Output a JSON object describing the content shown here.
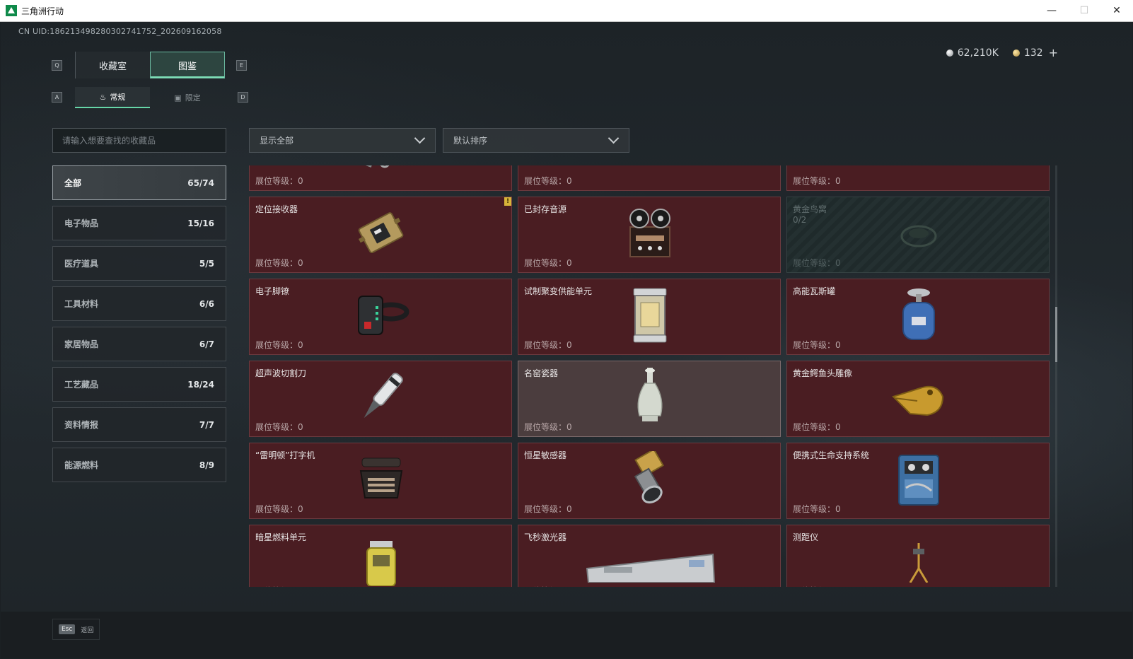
{
  "window": {
    "title": "三角洲行动"
  },
  "header": {
    "uid": "CN UID:1862134982803027417​52_202609162058",
    "currency": [
      {
        "icon": "silver-coin-icon",
        "value": "62,210K"
      },
      {
        "icon": "gold-coin-icon",
        "value": "132"
      }
    ],
    "plus": "+"
  },
  "keys": {
    "q": "Q",
    "e": "E",
    "a": "A",
    "d": "D"
  },
  "tabs": [
    {
      "label": "收藏室",
      "active": false
    },
    {
      "label": "图鉴",
      "active": true
    }
  ],
  "subtabs": [
    {
      "label": "常规",
      "icon": "flame-icon",
      "active": true
    },
    {
      "label": "限定",
      "icon": "image-icon",
      "active": false
    }
  ],
  "search": {
    "placeholder": "请输入想要查找的收藏品"
  },
  "filters": {
    "show": "显示全部",
    "sort": "默认排序"
  },
  "categories": [
    {
      "label": "全部",
      "count": "65/74",
      "active": true
    },
    {
      "label": "电子物品",
      "count": "15/16"
    },
    {
      "label": "医疗道具",
      "count": "5/5"
    },
    {
      "label": "工具材料",
      "count": "6/6"
    },
    {
      "label": "家居物品",
      "count": "6/7"
    },
    {
      "label": "工艺藏品",
      "count": "18/24"
    },
    {
      "label": "资料情报",
      "count": "7/7"
    },
    {
      "label": "能源燃料",
      "count": "8/9"
    }
  ],
  "level_label": "展位等级：0",
  "items": [
    {
      "name": "",
      "icon": "canister-icon"
    },
    {
      "name": "",
      "icon": "painting-icon"
    },
    {
      "name": "",
      "icon": "gold-frame-icon"
    },
    {
      "name": "定位接收器",
      "icon": "receiver-icon",
      "alert": "!"
    },
    {
      "name": "已封存音源",
      "icon": "reel-recorder-icon"
    },
    {
      "name": "黄金鸟窝",
      "icon": "bird-nest-icon",
      "locked": true,
      "progress": "0/2"
    },
    {
      "name": "电子脚镣",
      "icon": "ankle-monitor-icon"
    },
    {
      "name": "试制聚变供能单元",
      "icon": "fusion-cell-icon"
    },
    {
      "name": "高能瓦斯罐",
      "icon": "gas-tank-icon"
    },
    {
      "name": "超声波切割刀",
      "icon": "ultrasonic-cutter-icon"
    },
    {
      "name": "名窑瓷器",
      "icon": "porcelain-vase-icon",
      "gray": true
    },
    {
      "name": "黄金鳄鱼头雕像",
      "icon": "gold-crocodile-icon"
    },
    {
      "name": "“雷明顿”打字机",
      "icon": "typewriter-icon"
    },
    {
      "name": "恒星敏感器",
      "icon": "star-sensor-icon"
    },
    {
      "name": "便携式生命支持系统",
      "icon": "life-support-icon"
    },
    {
      "name": "暗星燃料单元",
      "icon": "fuel-cell-icon"
    },
    {
      "name": "飞秒激光器",
      "icon": "laser-icon"
    },
    {
      "name": "测距仪",
      "icon": "rangefinder-icon"
    }
  ],
  "footer": {
    "esc_key": "Esc",
    "esc_label": "返回"
  },
  "colors": {
    "card_bg": "#4a1d22",
    "accent": "#66d6a8"
  }
}
